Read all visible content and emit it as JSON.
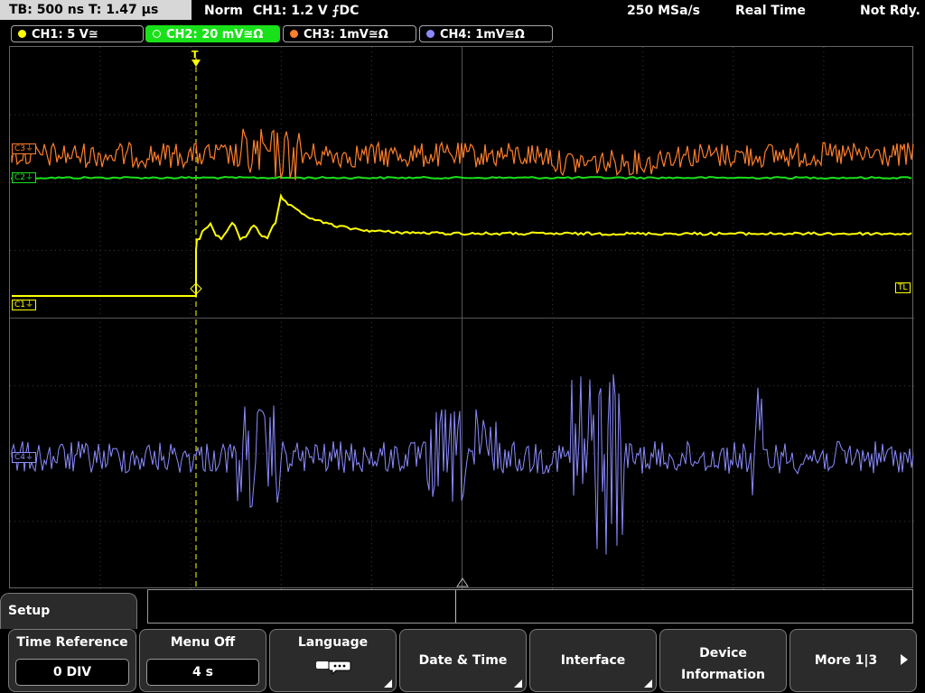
{
  "topbar": {
    "timebase": "TB: 500 ns  T: 1.47 µs",
    "mode": "Norm",
    "trigger": "CH1: 1.2 V ⨍DC",
    "sample_rate": "250 MSa/s",
    "acq_mode": "Real Time",
    "status": "Not Rdy."
  },
  "channels": [
    {
      "label": "CH1: 5 V≅",
      "color": "#ffff00"
    },
    {
      "label": "CH2: 20 mV≅Ω",
      "color": "#00ff00"
    },
    {
      "label": "CH3: 1mV≅Ω",
      "color": "#ff7f2a"
    },
    {
      "label": "CH4: 1mV≅Ω",
      "color": "#8b8bff"
    }
  ],
  "markers": {
    "trigger_pos": "T",
    "trigger_level": "TL",
    "ch1_ref": "C1⏚",
    "ch2_ref": "C2⏚",
    "ch3_ref": "C3⏚",
    "ch4_ref": "C4⏚"
  },
  "menu": {
    "title": "Setup",
    "time_reference_label": "Time Reference",
    "time_reference_value": "0 DIV",
    "menu_off_label": "Menu Off",
    "menu_off_value": "4 s",
    "language_label": "Language",
    "language_icon": "speech-bubble-icon",
    "date_time_label": "Date & Time",
    "interface_label": "Interface",
    "device_info_line1": "Device",
    "device_info_line2": "Information",
    "more_label": "More 1|3"
  }
}
